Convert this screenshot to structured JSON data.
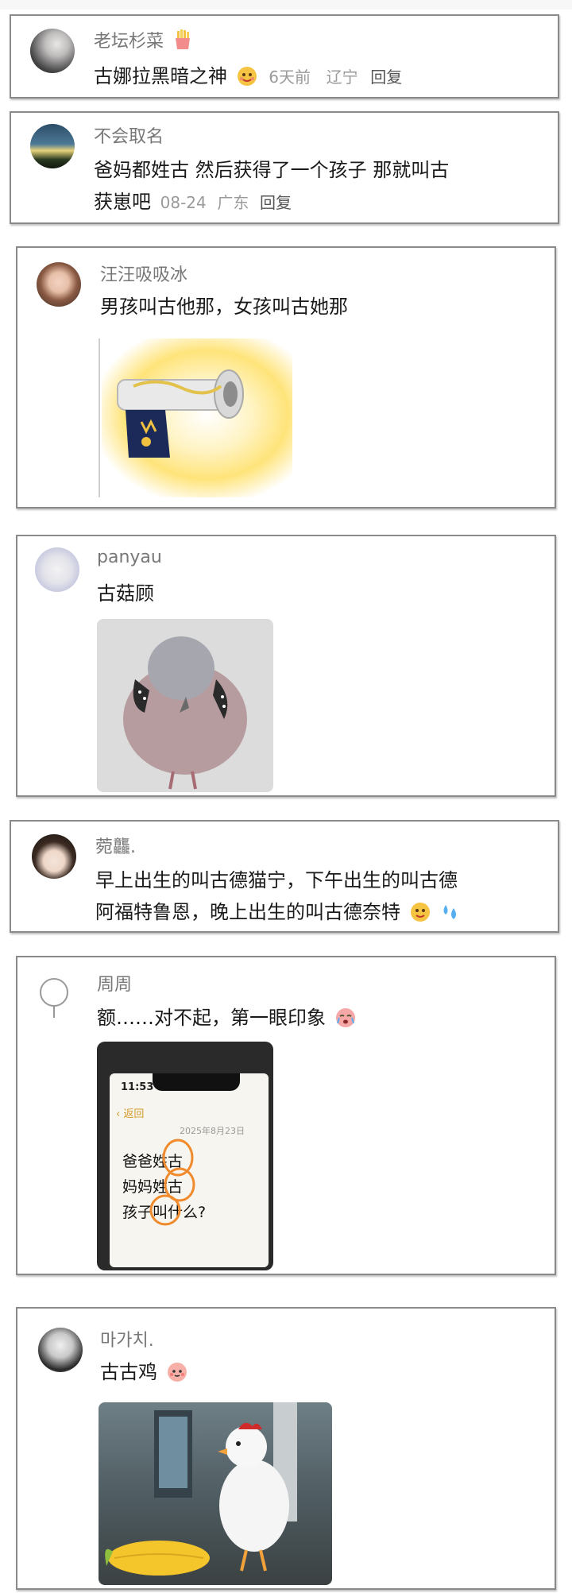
{
  "comments": [
    {
      "name": "老坛杉菜",
      "text": "古娜拉黑暗之神",
      "time": "6天前",
      "location": "辽宁",
      "reply": "回复"
    },
    {
      "name": "不会取名",
      "text_line1": "爸妈都姓古  然后获得了一个孩子  那就叫古",
      "text_line2": "获崽吧",
      "time": "08-24",
      "location": "广东",
      "reply": "回复"
    },
    {
      "name": "汪汪吸吸冰",
      "text": "男孩叫古他那，女孩叫古她那"
    },
    {
      "name": "panyau",
      "text": "古菇顾"
    },
    {
      "name": "菀龘.",
      "text_line1": "早上出生的叫古德猫宁，下午出生的叫古德",
      "text_line2": "阿福特鲁恩，晚上出生的叫古德奈特"
    },
    {
      "name": "周周",
      "text": "额……对不起，第一眼印象",
      "phone": {
        "time": "11:53",
        "back": "返回",
        "date": "2025年8月23日",
        "line1": "爸爸姓古",
        "line2": "妈妈姓古",
        "line3": "孩子叫什么?"
      }
    },
    {
      "name": "마가치.",
      "text": "古古鸡"
    }
  ]
}
